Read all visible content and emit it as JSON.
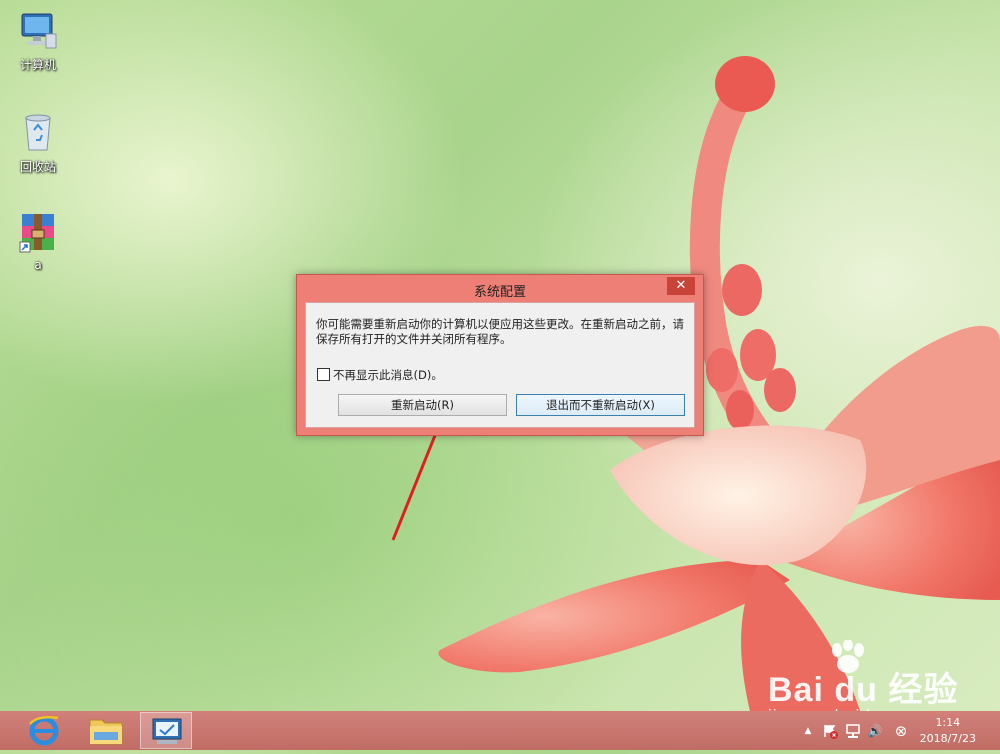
{
  "desktop": {
    "icons": [
      {
        "label": "计算机",
        "icon": "computer-icon"
      },
      {
        "label": "回收站",
        "icon": "recycle-bin-icon"
      },
      {
        "label": "a",
        "icon": "winrar-icon"
      }
    ]
  },
  "dialog": {
    "title": "系统配置",
    "close_glyph": "✕",
    "message": "你可能需要重新启动你的计算机以便应用这些更改。在重新启动之前，请保存所有打开的文件并关闭所有程序。",
    "checkbox_label": "不再显示此消息(D)。",
    "checkbox_checked": false,
    "restart_label": "重新启动(R)",
    "exit_label": "退出而不重新启动(X)"
  },
  "annotation": {
    "arrow_color": "#e02020"
  },
  "taskbar": {
    "apps": [
      {
        "name": "internet-explorer",
        "icon": "ie-icon"
      },
      {
        "name": "file-explorer",
        "icon": "folder-icon"
      },
      {
        "name": "system-configuration",
        "icon": "msconfig-icon",
        "active": true
      }
    ],
    "tray": {
      "show_hidden_glyph": "▲",
      "volume_glyph": "🔊",
      "close_glyph": "⊗"
    },
    "clock": {
      "time": "1:14",
      "date": "2018/7/23"
    }
  },
  "watermark": {
    "brand": "Bai du 经验",
    "site": "jingyan.baidu.com"
  },
  "colors": {
    "dialog_frame": "#ee7f76",
    "taskbar": "#c87570",
    "button_focus_border": "#3c7fb1"
  }
}
